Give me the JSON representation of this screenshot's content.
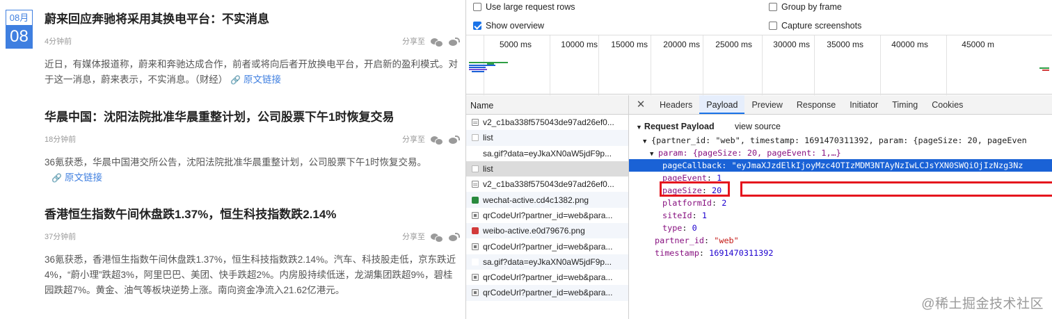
{
  "news": {
    "date": {
      "month": "08月",
      "day": "08"
    },
    "articles": [
      {
        "title": "蔚来回应奔驰将采用其换电平台：不实消息",
        "time": "4分钟前",
        "share": "分享至",
        "body": "近日，有媒体报道称，蔚来和奔驰达成合作，前者或将向后者开放换电平台，开启新的盈利模式。对于这一消息，蔚来表示，不实消息。（财经）",
        "link": "原文链接"
      },
      {
        "title": "华晨中国：沈阳法院批准华晨重整计划，公司股票下午1时恢复交易",
        "time": "18分钟前",
        "share": "分享至",
        "body": "36氪获悉，华晨中国港交所公告，沈阳法院批准华晨重整计划，公司股票下午1时恢复交易。",
        "link": "原文链接"
      },
      {
        "title": "香港恒生指数午间休盘跌1.37%，恒生科技指数跌2.14%",
        "time": "37分钟前",
        "share": "分享至",
        "body": "36氪获悉，香港恒生指数午间休盘跌1.37%，恒生科技指数跌2.14%。汽车、科技股走低，京东跌近4%，“蔚小理”跌超3%，阿里巴巴、美团、快手跌超2%。内房股持续低迷，龙湖集团跌超9%，碧桂园跌超7%。黄金、油气等板块逆势上涨。南向资金净流入21.62亿港元。",
        "link": ""
      }
    ]
  },
  "devtools": {
    "settings": {
      "large_rows": {
        "label": "Use large request rows",
        "checked": false
      },
      "show_overview": {
        "label": "Show overview",
        "checked": true
      },
      "group_by_frame": {
        "label": "Group by frame",
        "checked": false
      },
      "capture_screenshots": {
        "label": "Capture screenshots",
        "checked": false
      }
    },
    "timeline_ticks": [
      "5000 ms",
      "10000 ms",
      "15000 ms",
      "20000 ms",
      "25000 ms",
      "30000 ms",
      "35000 ms",
      "40000 ms",
      "45000 m"
    ],
    "name_header": "Name",
    "requests": [
      {
        "name": "v2_c1ba338f575043de97ad26ef0...",
        "icon": "doc"
      },
      {
        "name": "list",
        "icon": "xhr-box"
      },
      {
        "name": "sa.gif?data=eyJkaXN0aW5jdF9p...",
        "icon": "gif"
      },
      {
        "name": "list",
        "icon": "xhr-box"
      },
      {
        "name": "v2_c1ba338f575043de97ad26ef0...",
        "icon": "doc"
      },
      {
        "name": "wechat-active.cd4c1382.png",
        "icon": "img-green"
      },
      {
        "name": "qrCodeUrl?partner_id=web&para...",
        "icon": "xhr"
      },
      {
        "name": "weibo-active.e0d79676.png",
        "icon": "img-red"
      },
      {
        "name": "qrCodeUrl?partner_id=web&para...",
        "icon": "xhr"
      },
      {
        "name": "sa.gif?data=eyJkaXN0aW5jdF9p...",
        "icon": "gif"
      },
      {
        "name": "qrCodeUrl?partner_id=web&para...",
        "icon": "xhr"
      },
      {
        "name": "qrCodeUrl?partner_id=web&para...",
        "icon": "xhr"
      }
    ],
    "tabs": [
      "Headers",
      "Payload",
      "Preview",
      "Response",
      "Initiator",
      "Timing",
      "Cookies"
    ],
    "active_tab": "Payload",
    "payload": {
      "section_title": "Request Payload",
      "view_source": "view source",
      "root_summary": "{partner_id: \"web\", timestamp: 1691470311392, param: {pageSize: 20, pageEven",
      "param_summary": "param: {pageSize: 20, pageEvent: 1,…}",
      "page_callback_key": "pageCallback",
      "page_callback_value": "eyJmaXJzdElkIjoyMzc4OTIzMDM3NTAyNzIwLCJsYXN0SWQiOjIzNzg3Nz",
      "fields": [
        {
          "key": "pageEvent",
          "value": "1",
          "type": "num"
        },
        {
          "key": "pageSize",
          "value": "20",
          "type": "num"
        },
        {
          "key": "platformId",
          "value": "2",
          "type": "num"
        },
        {
          "key": "siteId",
          "value": "1",
          "type": "num"
        },
        {
          "key": "type",
          "value": "0",
          "type": "num"
        }
      ],
      "partner_id": {
        "key": "partner_id",
        "value": "\"web\""
      },
      "timestamp": {
        "key": "timestamp",
        "value": "1691470311392"
      }
    }
  },
  "watermark": "@稀土掘金技术社区"
}
